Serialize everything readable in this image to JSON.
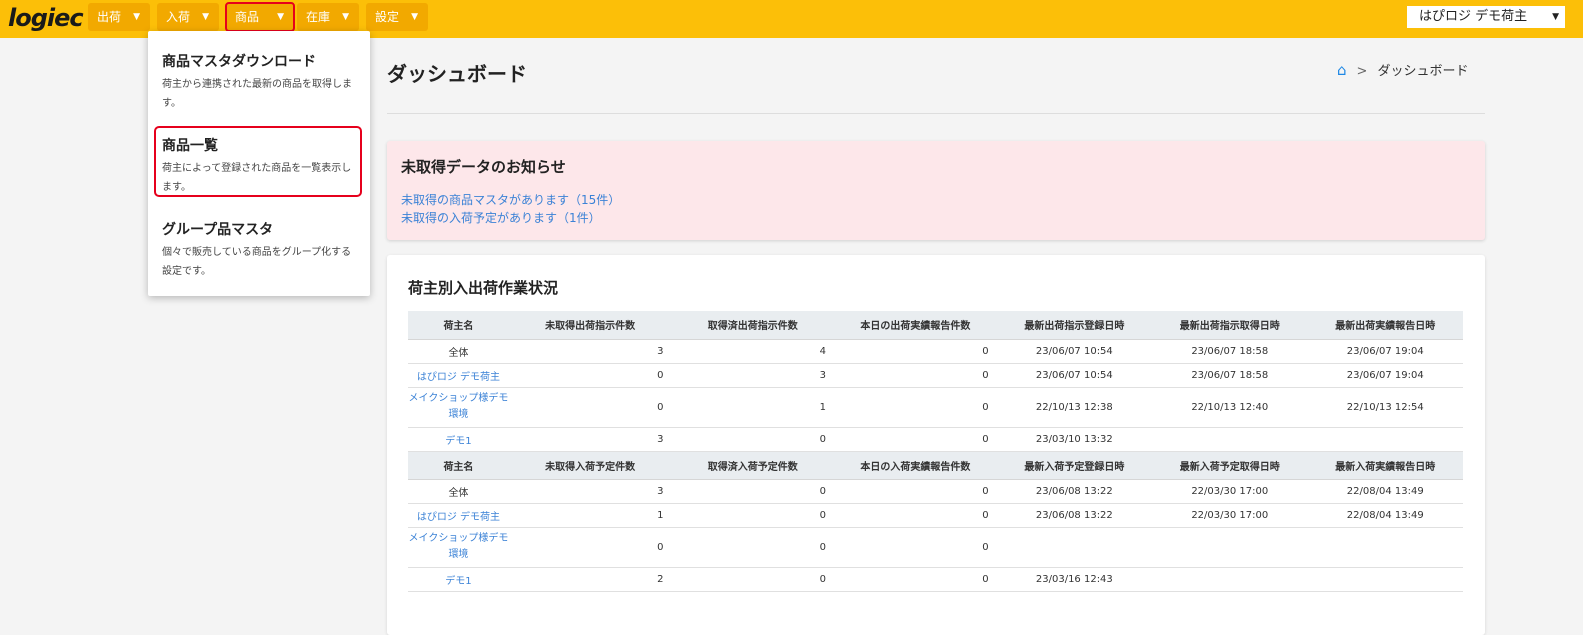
{
  "brand": {
    "logo_text": "logiec"
  },
  "nav": {
    "items": [
      {
        "label": "出荷"
      },
      {
        "label": "入荷"
      },
      {
        "label": "商品"
      },
      {
        "label": "在庫"
      },
      {
        "label": "設定"
      }
    ],
    "active": "商品"
  },
  "shipper_select": {
    "value": "はぴロジ デモ荷主"
  },
  "dropdown": {
    "items": [
      {
        "title": "商品マスタダウンロード",
        "desc": "荷主から連携された最新の商品を取得します。"
      },
      {
        "title": "商品一覧",
        "desc": "荷主によって登録された商品を一覧表示します。"
      },
      {
        "title": "グループ品マスタ",
        "desc": "個々で販売している商品をグループ化する設定です。"
      }
    ]
  },
  "page": {
    "title": "ダッシュボード",
    "breadcrumb": {
      "home_icon": "home-icon",
      "current": "ダッシュボード"
    }
  },
  "notice": {
    "title": "未取得データのお知らせ",
    "links": [
      "未取得の商品マスタがあります（15件）",
      "未取得の入荷予定があります（1件）"
    ]
  },
  "status": {
    "title": "荷主別入出荷作業状況",
    "shipping_headers": [
      "荷主名",
      "未取得出荷指示件数",
      "取得済出荷指示件数",
      "本日の出荷実績報告件数",
      "最新出荷指示登録日時",
      "最新出荷指示取得日時",
      "最新出荷実績報告日時"
    ],
    "shipping_rows": [
      [
        "全体",
        "3",
        "4",
        "0",
        "23/06/07 10:54",
        "23/06/07 18:58",
        "23/06/07 19:04"
      ],
      [
        "はぴロジ デモ荷主",
        "0",
        "3",
        "0",
        "23/06/07 10:54",
        "23/06/07 18:58",
        "23/06/07 19:04"
      ],
      [
        "メイクショップ様デモ環境",
        "0",
        "1",
        "0",
        "22/10/13 12:38",
        "22/10/13 12:40",
        "22/10/13 12:54"
      ],
      [
        "デモ1",
        "3",
        "0",
        "0",
        "23/03/10 13:32",
        "",
        ""
      ]
    ],
    "receiving_headers": [
      "荷主名",
      "未取得入荷予定件数",
      "取得済入荷予定件数",
      "本日の入荷実績報告件数",
      "最新入荷予定登録日時",
      "最新入荷予定取得日時",
      "最新入荷実績報告日時"
    ],
    "receiving_rows": [
      [
        "全体",
        "3",
        "0",
        "0",
        "23/06/08 13:22",
        "22/03/30 17:00",
        "22/08/04 13:49"
      ],
      [
        "はぴロジ デモ荷主",
        "1",
        "0",
        "0",
        "23/06/08 13:22",
        "22/03/30 17:00",
        "22/08/04 13:49"
      ],
      [
        "メイクショップ様デモ環境",
        "0",
        "0",
        "0",
        "",
        "",
        ""
      ],
      [
        "デモ1",
        "2",
        "0",
        "0",
        "23/03/16 12:43",
        "",
        ""
      ]
    ]
  },
  "colors": {
    "topbar": "#fcbf08",
    "nav_button": "#f2a900",
    "link": "#3b82d6",
    "highlight": "#e6001c",
    "notice_bg": "#fde7ea"
  }
}
